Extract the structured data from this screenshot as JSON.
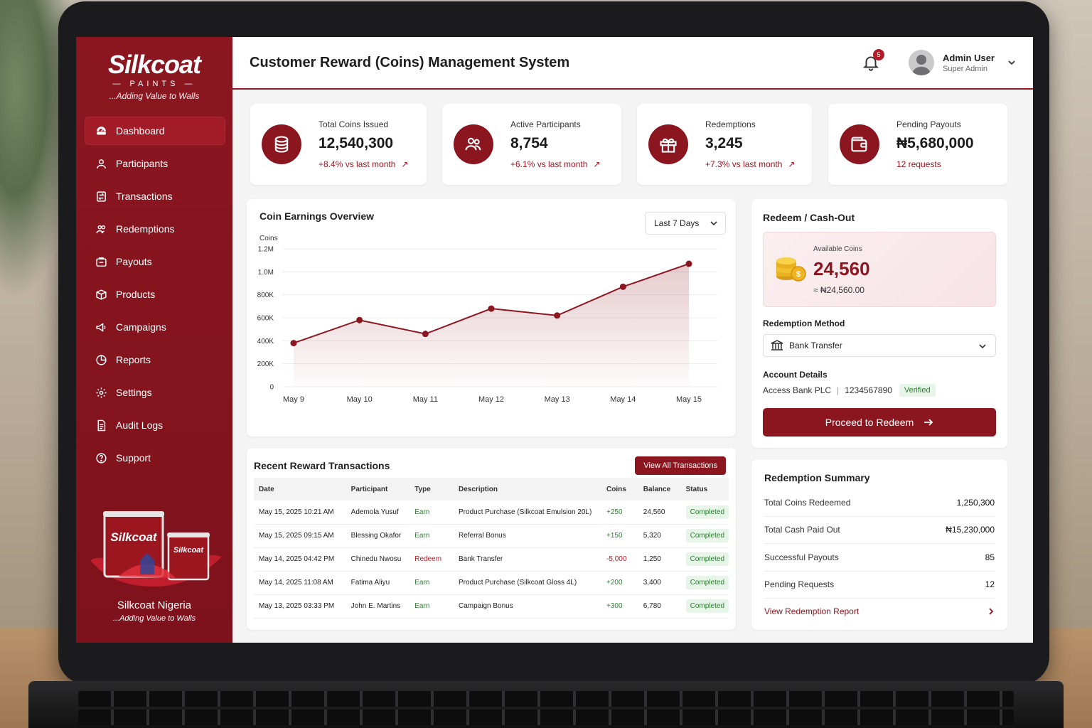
{
  "brand": {
    "name": "Silkcoat",
    "sub": "PAINTS",
    "tagline": "...Adding Value to Walls"
  },
  "sidebar": {
    "items": [
      {
        "label": "Dashboard",
        "icon": "dashboard-icon",
        "active": true
      },
      {
        "label": "Participants",
        "icon": "user-icon"
      },
      {
        "label": "Transactions",
        "icon": "transactions-icon"
      },
      {
        "label": "Redemptions",
        "icon": "redemptions-icon"
      },
      {
        "label": "Payouts",
        "icon": "payouts-icon"
      },
      {
        "label": "Products",
        "icon": "box-icon"
      },
      {
        "label": "Campaigns",
        "icon": "megaphone-icon"
      },
      {
        "label": "Reports",
        "icon": "reports-icon"
      },
      {
        "label": "Settings",
        "icon": "gear-icon"
      },
      {
        "label": "Audit Logs",
        "icon": "document-icon"
      },
      {
        "label": "Support",
        "icon": "help-icon"
      }
    ],
    "promo": {
      "title": "Silkcoat Nigeria",
      "tagline": "...Adding Value to Walls",
      "can_brand": "Silkcoat",
      "can_brand_small": "Silkcoat"
    }
  },
  "header": {
    "title": "Customer Reward (Coins) Management System",
    "notification_count": "5",
    "user_name": "Admin User",
    "user_role": "Super Admin"
  },
  "stats": [
    {
      "label": "Total Coins Issued",
      "value": "12,540,300",
      "change": "+8.4% vs last month",
      "icon": "coins-icon"
    },
    {
      "label": "Active Participants",
      "value": "8,754",
      "change": "+6.1% vs last month",
      "icon": "users-icon"
    },
    {
      "label": "Redemptions",
      "value": "3,245",
      "change": "+7.3% vs last month",
      "icon": "gift-icon"
    },
    {
      "label": "Pending Payouts",
      "value": "₦5,680,000",
      "change": "12 requests",
      "icon": "wallet-icon"
    }
  ],
  "chart_title": "Coin Earnings Overview",
  "chart_range": "Last 7 Days",
  "chart_data": {
    "type": "area",
    "title": "Coin Earnings Overview",
    "ylabel": "Coins",
    "xlabel": "",
    "categories": [
      "May 9",
      "May 10",
      "May 11",
      "May 12",
      "May 13",
      "May 14",
      "May 15"
    ],
    "values": [
      380000,
      580000,
      460000,
      680000,
      620000,
      870000,
      1070000
    ],
    "ylim": [
      0,
      1200000
    ],
    "yticks": [
      "0",
      "200K",
      "400K",
      "600K",
      "800K",
      "1.0M",
      "1.2M"
    ],
    "grid": true,
    "color": "#8b1620"
  },
  "transactions": {
    "title": "Recent Reward Transactions",
    "view_all": "View All Transactions",
    "columns": [
      "Date",
      "Participant",
      "Type",
      "Description",
      "Coins",
      "Balance",
      "Status"
    ],
    "rows": [
      [
        "May 15, 2025 10:21 AM",
        "Ademola Yusuf",
        "Earn",
        "Product Purchase (Silkcoat Emulsion 20L)",
        "+250",
        "24,560",
        "Completed"
      ],
      [
        "May 15, 2025 09:15 AM",
        "Blessing Okafor",
        "Earn",
        "Referral Bonus",
        "+150",
        "5,320",
        "Completed"
      ],
      [
        "May 14, 2025 04:42 PM",
        "Chinedu Nwosu",
        "Redeem",
        "Bank Transfer",
        "-5,000",
        "1,250",
        "Completed"
      ],
      [
        "May 14, 2025 11:08 AM",
        "Fatima Aliyu",
        "Earn",
        "Product Purchase (Silkcoat Gloss 4L)",
        "+200",
        "3,400",
        "Completed"
      ],
      [
        "May 13, 2025 03:33 PM",
        "John E. Martins",
        "Earn",
        "Campaign Bonus",
        "+300",
        "6,780",
        "Completed"
      ]
    ]
  },
  "redeem": {
    "title": "Redeem / Cash-Out",
    "available_label": "Available Coins",
    "available_value": "24,560",
    "available_naira": "≈ ₦24,560.00",
    "method_label": "Redemption Method",
    "method_value": "Bank Transfer",
    "account_label": "Account Details",
    "bank": "Access Bank PLC",
    "account_number": "1234567890",
    "verified": "Verified",
    "proceed": "Proceed to Redeem"
  },
  "summary": {
    "title": "Redemption Summary",
    "rows": [
      {
        "label": "Total Coins Redeemed",
        "value": "1,250,300"
      },
      {
        "label": "Total Cash Paid Out",
        "value": "₦15,230,000"
      },
      {
        "label": "Successful Payouts",
        "value": "85"
      },
      {
        "label": "Pending Requests",
        "value": "12"
      }
    ],
    "link": "View Redemption Report"
  }
}
